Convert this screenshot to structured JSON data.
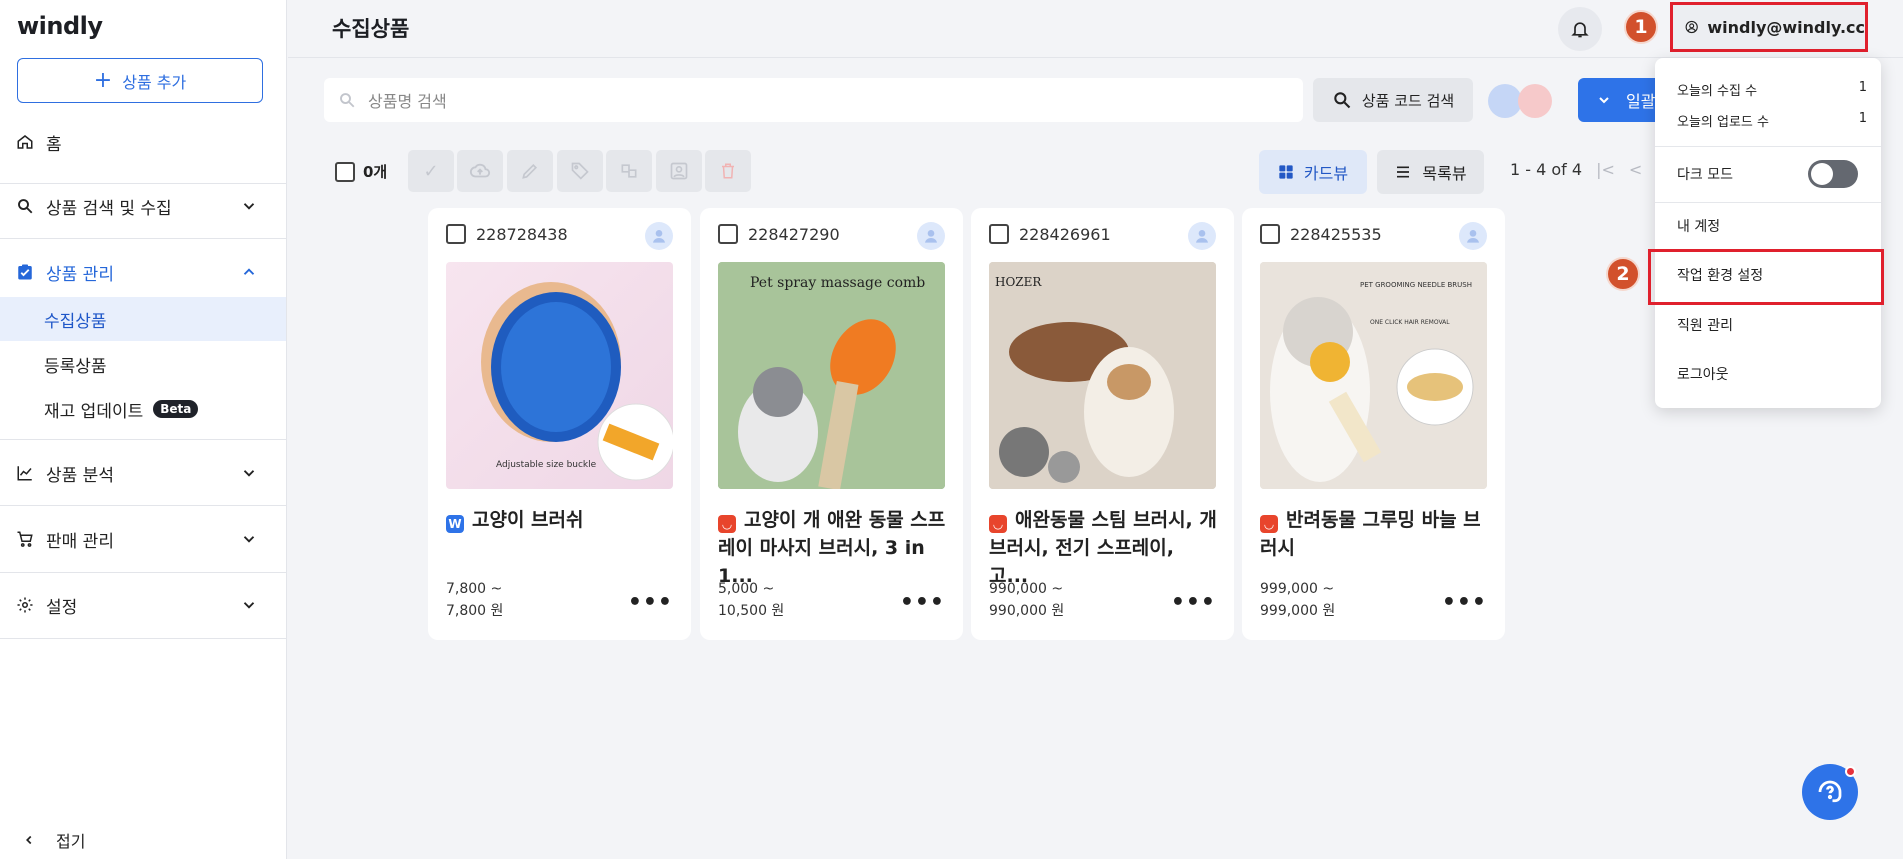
{
  "app": {
    "logo": "windly"
  },
  "sidebar": {
    "add_button": "상품 추가",
    "items": [
      {
        "label": "홈",
        "icon": "home-icon"
      },
      {
        "label": "상품 검색 및 수집",
        "icon": "search-icon"
      },
      {
        "label": "상품 관리",
        "icon": "clipboard-check-icon"
      },
      {
        "label": "상품 분석",
        "icon": "chart-icon"
      },
      {
        "label": "판매 관리",
        "icon": "cart-icon"
      },
      {
        "label": "설정",
        "icon": "gear-icon"
      }
    ],
    "sub_items": [
      {
        "label": "수집상품"
      },
      {
        "label": "등록상품"
      },
      {
        "label": "재고 업데이트",
        "badge": "Beta"
      }
    ],
    "collapse_label": "접기"
  },
  "header": {
    "title": "수집상품",
    "user_email": "windly@windly.cc",
    "step1": "1",
    "step2": "2"
  },
  "search": {
    "placeholder": "상품명 검색",
    "code_button": "상품 코드 검색",
    "bulk_button": "일괄"
  },
  "toolbar": {
    "selected_count": "0개",
    "view_card": "카드뷰",
    "view_list": "목록뷰",
    "range": "1 - 4 of 4",
    "page": "1"
  },
  "products": [
    {
      "id": "228728438",
      "title": "고양이 브러쉬",
      "price_min": "7,800 ~",
      "price_max": "7,800 원",
      "marker": "W",
      "marker_color": "#2e73e8"
    },
    {
      "id": "228427290",
      "title": "고양이 개 애완 동물 스프레이 마사지 브러시, 3 in 1...",
      "price_min": "5,000 ~",
      "price_max": "10,500 원",
      "marker": "",
      "marker_color": "#e8452c",
      "image_text": "Pet spray massage comb"
    },
    {
      "id": "228426961",
      "title": "애완동물 스팀 브러시, 개 브러시, 전기 스프레이, 고...",
      "price_min": "990,000 ~",
      "price_max": "990,000 원",
      "marker": "",
      "marker_color": "#e8452c",
      "image_text": "HOZER"
    },
    {
      "id": "228425535",
      "title": "반려동물 그루밍 바늘 브러시",
      "price_min": "999,000 ~",
      "price_max": "999,000 원",
      "marker": "",
      "marker_color": "#e8452c",
      "image_text": "PET GROOMING NEEDLE BRUSH",
      "image_text2": "ONE CLICK HAIR REMOVAL"
    }
  ],
  "product1_image_text": "Adjustable size buckle",
  "dropdown": {
    "stat1_label": "오늘의 수집 수",
    "stat1_value": "1",
    "stat2_label": "오늘의 업로드 수",
    "stat2_value": "1",
    "dark_mode": "다크 모드",
    "my_account": "내 계정",
    "workspace": "작업 환경 설정",
    "staff": "직원 관리",
    "logout": "로그아웃"
  },
  "colors": {
    "accent": "#2e73e8",
    "highlight": "#e0202d",
    "step_badge": "#d2512c"
  }
}
